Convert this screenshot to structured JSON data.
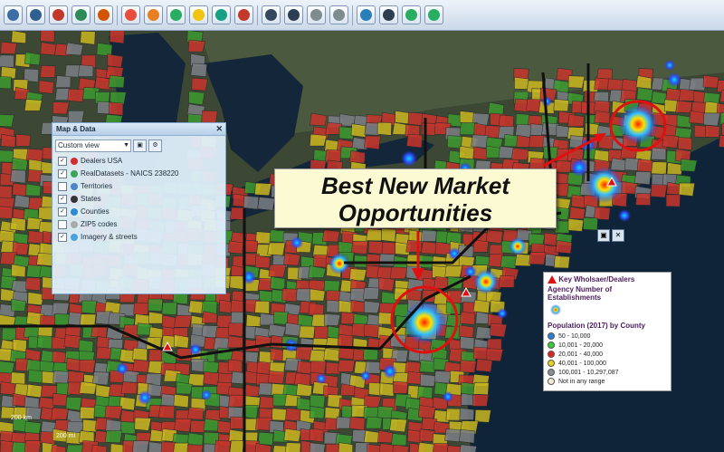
{
  "toolbar": {
    "buttons": [
      {
        "name": "save-icon",
        "color": "#3a6ea5"
      },
      {
        "name": "people-icon",
        "color": "#2f5f8f"
      },
      {
        "name": "pin-icon",
        "color": "#c0392b"
      },
      {
        "name": "globe-icon",
        "color": "#2e8b57"
      },
      {
        "name": "target-icon",
        "color": "#d35400"
      },
      {
        "name": "circle-icon",
        "color": "#e74c3c"
      },
      {
        "name": "territory-icon",
        "color": "#e67e22"
      },
      {
        "name": "layers-icon",
        "color": "#27ae60"
      },
      {
        "name": "heatmap-icon",
        "color": "#f1c40f"
      },
      {
        "name": "route-icon",
        "color": "#16a085"
      },
      {
        "name": "delete-icon",
        "color": "#c0392b"
      },
      {
        "name": "search-icon",
        "color": "#34495e"
      },
      {
        "name": "chart-icon",
        "color": "#2c3e50"
      },
      {
        "name": "ruler-icon",
        "color": "#7f8c8d"
      },
      {
        "name": "print-icon",
        "color": "#7f8c8d"
      },
      {
        "name": "world-icon",
        "color": "#2980b9"
      },
      {
        "name": "table-icon",
        "color": "#2c3e50"
      },
      {
        "name": "export-icon",
        "color": "#27ae60"
      },
      {
        "name": "help-icon",
        "color": "#27ae60"
      }
    ]
  },
  "panel": {
    "title": "Map & Data",
    "view": "Custom view",
    "layers": [
      {
        "label": "Dealers USA",
        "checked": true,
        "icon": "triangle-icon",
        "color": "#d42b2b"
      },
      {
        "label": "RealDatasets - NAICS 238220",
        "checked": true,
        "icon": "heat-icon",
        "color": "#3aa655"
      },
      {
        "label": "Territories",
        "checked": false,
        "icon": "territory-icon",
        "color": "#4a86c8"
      },
      {
        "label": "States",
        "checked": true,
        "icon": "circle-outline-icon",
        "color": "#333333"
      },
      {
        "label": "Counties",
        "checked": true,
        "icon": "county-icon",
        "color": "#2e8bd1"
      },
      {
        "label": "ZIP5 codes",
        "checked": false,
        "icon": "zip-icon",
        "color": "#aaaaaa"
      },
      {
        "label": "Imagery & streets",
        "checked": true,
        "icon": "imagery-icon",
        "color": "#4aa3df"
      }
    ]
  },
  "headline": {
    "line1": "Best New Market",
    "line2": "Opportunities"
  },
  "legend": {
    "title1": "Key Wholsaer/Dealers",
    "title2": "Agency Number of Establishments",
    "title3": "Population (2017) by County",
    "ranges": [
      {
        "label": "50 - 10,000",
        "color": "#2e7fd6"
      },
      {
        "label": "10,001 - 20,000",
        "color": "#33cc33"
      },
      {
        "label": "20,001 - 40,000",
        "color": "#e02424"
      },
      {
        "label": "40,001 - 100,000",
        "color": "#e6d21c"
      },
      {
        "label": "100,001 - 10,297,087",
        "color": "#8a8f95"
      },
      {
        "label": "Not in any range",
        "color": "#f3ead8"
      }
    ]
  },
  "scale": {
    "a": "200 km",
    "b": "200 mi"
  },
  "map_colors": {
    "red": "#c8352c",
    "yellow": "#c9b621",
    "green": "#3c9a2f",
    "gray": "#7b7f84",
    "water": "#0f2438",
    "land": "#3e4a35"
  }
}
